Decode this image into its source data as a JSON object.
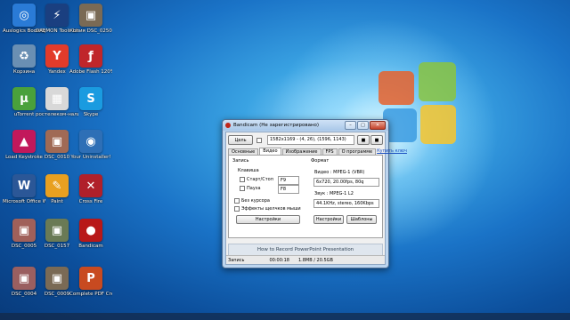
{
  "desktop": {
    "icons": [
      {
        "label": "Auslogics BoostSpeed",
        "name": "auslogics-icon",
        "color": "#2a7bd6",
        "glyph": "◎"
      },
      {
        "label": "DAEMON Tools Lite",
        "name": "daemon-tools-icon",
        "color": "#1a3f80",
        "glyph": "⚡"
      },
      {
        "label": "Копия DSC_0250",
        "name": "photo-file-icon",
        "color": "#7a6a55",
        "glyph": "▣"
      },
      {
        "label": "Корзина",
        "name": "recycle-bin-icon",
        "color": "#6a8fb3",
        "glyph": "♻"
      },
      {
        "label": "Yandex",
        "name": "yandex-icon",
        "color": "#e23b2a",
        "glyph": "Y"
      },
      {
        "label": "Adobe Flash 120%",
        "name": "flash-icon",
        "color": "#c0262a",
        "glyph": "ƒ"
      },
      {
        "label": "uTorrent",
        "name": "utorrent-icon",
        "color": "#4aa13b",
        "glyph": "µ"
      },
      {
        "label": "ростелеком-нализ",
        "name": "rostelecom-icon",
        "color": "#d8d8d8",
        "glyph": "▦"
      },
      {
        "label": "Skype",
        "name": "skype-icon",
        "color": "#1a9be0",
        "glyph": "S"
      },
      {
        "label": "Load Keystroke",
        "name": "app-icon",
        "color": "#c2185b",
        "glyph": "▲"
      },
      {
        "label": "DSC_0010",
        "name": "photo-file-icon-2",
        "color": "#a06a55",
        "glyph": "▣"
      },
      {
        "label": "Your Uninstaller!",
        "name": "uninstaller-icon",
        "color": "#2e6fb6",
        "glyph": "◉"
      },
      {
        "label": "Microsoft Office Word",
        "name": "word-icon",
        "color": "#2b5797",
        "glyph": "W"
      },
      {
        "label": "Paint",
        "name": "paint-icon",
        "color": "#e8a020",
        "glyph": "✎"
      },
      {
        "label": "Cross Fire",
        "name": "crossfire-icon",
        "color": "#b0202a",
        "glyph": "✕"
      },
      {
        "label": "DSC_0005",
        "name": "photo-file-icon-3",
        "color": "#a0605a",
        "glyph": "▣"
      },
      {
        "label": "DSC_0157",
        "name": "photo-file-icon-4",
        "color": "#6a7a55",
        "glyph": "▣"
      },
      {
        "label": "Bandicam",
        "name": "bandicam-icon",
        "color": "#b81818",
        "glyph": "●"
      },
      {
        "label": "DSC_0004",
        "name": "photo-file-icon-5",
        "color": "#9a5f60",
        "glyph": "▣"
      },
      {
        "label": "DSC_0009",
        "name": "photo-file-icon-6",
        "color": "#7a6a55",
        "glyph": "▣"
      },
      {
        "label": "Complete PDF Creator fre...",
        "name": "pdf-creator-icon",
        "color": "#c84a20",
        "glyph": "P"
      }
    ]
  },
  "window": {
    "title": "Bandicam (Не зарегистрировано)",
    "target_button": "Цель",
    "coords": "1582x1169 - (4, 26), (1596, 1143)",
    "tabs": [
      "Основные",
      "Видео",
      "Изображение",
      "FPS",
      "О программе"
    ],
    "buy_link": "Купить ключ",
    "recording_group": "Запись",
    "hotkey_label": "Клавиша",
    "start_stop_label": "Старт/Стоп",
    "start_stop_key": "F9",
    "pause_label": "Пауза",
    "pause_key": "F8",
    "no_cursor_label": "Без курсора",
    "mouse_effects_label": "Эффекты щелчков мыши",
    "settings_button": "Настройки",
    "format_group": "Формат",
    "video_info": "Видео : MPEG-1 (VBR)",
    "video_detail": "6x720, 20.00fps, 80q",
    "audio_info": "Звук : MPEG-1 L2",
    "audio_detail": "44.1KHz, stereo, 160Kbps",
    "format_settings_button": "Настройки",
    "templates_button": "Шаблоны",
    "banner": "How to Record PowerPoint Presentation",
    "status_label": "Запись",
    "status_time": "00:00:18",
    "status_size": "1.8MB / 20.5GB"
  }
}
